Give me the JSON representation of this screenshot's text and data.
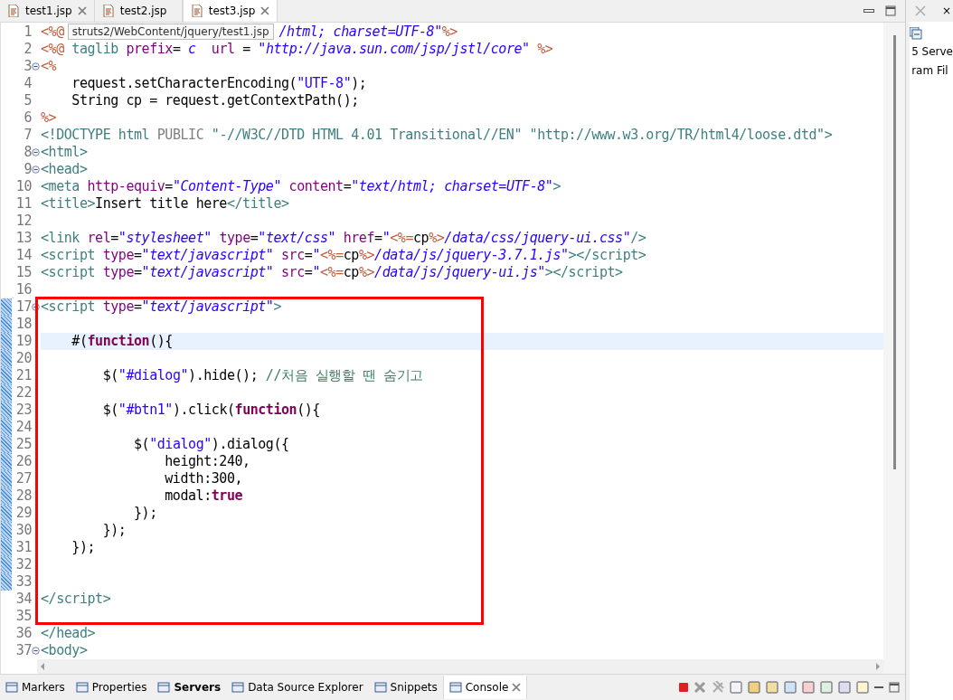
{
  "editor_tabs": [
    {
      "label": "test1.jsp",
      "selected": false,
      "closable": true
    },
    {
      "label": "test2.jsp",
      "selected": false,
      "closable": false
    },
    {
      "label": "test3.jsp",
      "selected": true,
      "closable": true
    }
  ],
  "blocks": [
    {
      "boxed": false,
      "lines": [
        {
          "number": "1",
          "fold": false,
          "changed": false,
          "current": false,
          "tokens": [
            {
              "kind": "jsp",
              "text": "<%@"
            },
            {
              "kind": "tooltip",
              "text": "struts2/WebContent/jquery/test1.jsp"
            },
            {
              "kind": "value",
              "text": "/html; charset=UTF-8\""
            },
            {
              "kind": "jsp",
              "text": "%>"
            }
          ]
        },
        {
          "number": "2",
          "fold": false,
          "changed": false,
          "current": false,
          "tokens": [
            {
              "kind": "jsp",
              "text": "<%@"
            },
            {
              "kind": "tag",
              "text": " taglib"
            },
            {
              "kind": "attr",
              "text": " prefix"
            },
            {
              "kind": "text",
              "text": "="
            },
            {
              "kind": "value",
              "text": " c"
            },
            {
              "kind": "attr",
              "text": "  url"
            },
            {
              "kind": "text",
              "text": " = "
            },
            {
              "kind": "value",
              "text": "\"http://java.sun.com/jsp/jstl/core\""
            },
            {
              "kind": "jsp",
              "text": " %>"
            }
          ]
        },
        {
          "number": "3",
          "fold": true,
          "changed": false,
          "current": false,
          "tokens": [
            {
              "kind": "jsp",
              "text": "<%"
            }
          ]
        },
        {
          "number": "4",
          "fold": false,
          "changed": false,
          "current": false,
          "tokens": [
            {
              "kind": "text",
              "text": "    request.setCharacterEncoding("
            },
            {
              "kind": "string",
              "text": "\"UTF-8\""
            },
            {
              "kind": "text",
              "text": ");"
            }
          ]
        },
        {
          "number": "5",
          "fold": false,
          "changed": false,
          "current": false,
          "tokens": [
            {
              "kind": "text",
              "text": "    String cp = request.getContextPath();"
            }
          ]
        },
        {
          "number": "6",
          "fold": false,
          "changed": false,
          "current": false,
          "tokens": [
            {
              "kind": "jsp",
              "text": "%>"
            }
          ]
        },
        {
          "number": "7",
          "fold": false,
          "changed": false,
          "current": false,
          "tokens": [
            {
              "kind": "tag",
              "text": "<!DOCTYPE html"
            },
            {
              "kind": "doctype",
              "text": " PUBLIC "
            },
            {
              "kind": "tag",
              "text": "\"-//W3C//DTD HTML 4.01 Transitional//EN\" \"http://www.w3.org/TR/html4/loose.dtd\">"
            }
          ]
        },
        {
          "number": "8",
          "fold": true,
          "changed": false,
          "current": false,
          "tokens": [
            {
              "kind": "tag",
              "text": "<html>"
            }
          ]
        },
        {
          "number": "9",
          "fold": true,
          "changed": false,
          "current": false,
          "tokens": [
            {
              "kind": "tag",
              "text": "<head>"
            }
          ]
        },
        {
          "number": "10",
          "fold": false,
          "changed": false,
          "current": false,
          "tokens": [
            {
              "kind": "tag",
              "text": "<meta"
            },
            {
              "kind": "attr",
              "text": " http-equiv"
            },
            {
              "kind": "text",
              "text": "="
            },
            {
              "kind": "value",
              "text": "\"Content-Type\""
            },
            {
              "kind": "attr",
              "text": " content"
            },
            {
              "kind": "text",
              "text": "="
            },
            {
              "kind": "value",
              "text": "\"text/html; charset=UTF-8\""
            },
            {
              "kind": "tag",
              "text": ">"
            }
          ]
        },
        {
          "number": "11",
          "fold": false,
          "changed": false,
          "current": false,
          "tokens": [
            {
              "kind": "tag",
              "text": "<title>"
            },
            {
              "kind": "text",
              "text": "Insert title here"
            },
            {
              "kind": "tag",
              "text": "</title>"
            }
          ]
        },
        {
          "number": "12",
          "fold": false,
          "changed": false,
          "current": false
        },
        {
          "number": "13",
          "fold": false,
          "changed": false,
          "current": false,
          "tokens": [
            {
              "kind": "tag",
              "text": "<link"
            },
            {
              "kind": "attr",
              "text": " rel"
            },
            {
              "kind": "text",
              "text": "="
            },
            {
              "kind": "value",
              "text": "\"stylesheet\""
            },
            {
              "kind": "attr",
              "text": " type"
            },
            {
              "kind": "text",
              "text": "="
            },
            {
              "kind": "value",
              "text": "\"text/css\""
            },
            {
              "kind": "attr",
              "text": " href"
            },
            {
              "kind": "text",
              "text": "="
            },
            {
              "kind": "value",
              "text": "\""
            },
            {
              "kind": "jsp",
              "text": "<%="
            },
            {
              "kind": "text",
              "text": "cp"
            },
            {
              "kind": "jsp",
              "text": "%>"
            },
            {
              "kind": "value",
              "text": "/data/css/jquery-ui.css\""
            },
            {
              "kind": "tag",
              "text": "/>"
            }
          ]
        },
        {
          "number": "14",
          "fold": false,
          "changed": false,
          "current": false,
          "tokens": [
            {
              "kind": "tag",
              "text": "<script"
            },
            {
              "kind": "attr",
              "text": " type"
            },
            {
              "kind": "text",
              "text": "="
            },
            {
              "kind": "value",
              "text": "\"text/javascript\""
            },
            {
              "kind": "attr",
              "text": " src"
            },
            {
              "kind": "text",
              "text": "="
            },
            {
              "kind": "value",
              "text": "\""
            },
            {
              "kind": "jsp",
              "text": "<%="
            },
            {
              "kind": "text",
              "text": "cp"
            },
            {
              "kind": "jsp",
              "text": "%>"
            },
            {
              "kind": "value",
              "text": "/data/js/jquery-3.7.1.js\""
            },
            {
              "kind": "tag",
              "text": "></script>"
            }
          ]
        },
        {
          "number": "15",
          "fold": false,
          "changed": false,
          "current": false,
          "tokens": [
            {
              "kind": "tag",
              "text": "<script"
            },
            {
              "kind": "attr",
              "text": " type"
            },
            {
              "kind": "text",
              "text": "="
            },
            {
              "kind": "value",
              "text": "\"text/javascript\""
            },
            {
              "kind": "attr",
              "text": " src"
            },
            {
              "kind": "text",
              "text": "="
            },
            {
              "kind": "value",
              "text": "\""
            },
            {
              "kind": "jsp",
              "text": "<%="
            },
            {
              "kind": "text",
              "text": "cp"
            },
            {
              "kind": "jsp",
              "text": "%>"
            },
            {
              "kind": "value",
              "text": "/data/js/jquery-ui.js\""
            },
            {
              "kind": "tag",
              "text": "></script>"
            }
          ]
        },
        {
          "number": "16",
          "fold": false,
          "changed": false,
          "current": false
        }
      ]
    },
    {
      "boxed": true,
      "lines": [
        {
          "number": "17",
          "fold": true,
          "changed": true,
          "current": false,
          "tokens": [
            {
              "kind": "tag",
              "text": "<script"
            },
            {
              "kind": "attr",
              "text": " type"
            },
            {
              "kind": "text",
              "text": "="
            },
            {
              "kind": "value",
              "text": "\"text/javascript\""
            },
            {
              "kind": "tag",
              "text": ">"
            }
          ]
        },
        {
          "number": "18",
          "fold": false,
          "changed": true,
          "current": false
        },
        {
          "number": "19",
          "fold": false,
          "changed": true,
          "current": true,
          "tokens": [
            {
              "kind": "text",
              "text": "    #("
            },
            {
              "kind": "keyword",
              "text": "function"
            },
            {
              "kind": "text",
              "text": "(){"
            }
          ]
        },
        {
          "number": "20",
          "fold": false,
          "changed": true,
          "current": false
        },
        {
          "number": "21",
          "fold": false,
          "changed": true,
          "current": false,
          "tokens": [
            {
              "kind": "text",
              "text": "        $("
            },
            {
              "kind": "string",
              "text": "\"#dialog\""
            },
            {
              "kind": "text",
              "text": ").hide(); "
            },
            {
              "kind": "comment",
              "text": "//처음 실행할 땐 숨기고"
            }
          ]
        },
        {
          "number": "22",
          "fold": false,
          "changed": true,
          "current": false
        },
        {
          "number": "23",
          "fold": false,
          "changed": true,
          "current": false,
          "tokens": [
            {
              "kind": "text",
              "text": "        $("
            },
            {
              "kind": "string",
              "text": "\"#btn1\""
            },
            {
              "kind": "text",
              "text": ").click("
            },
            {
              "kind": "keyword",
              "text": "function"
            },
            {
              "kind": "text",
              "text": "(){"
            }
          ]
        },
        {
          "number": "24",
          "fold": false,
          "changed": true,
          "current": false
        },
        {
          "number": "25",
          "fold": false,
          "changed": true,
          "current": false,
          "tokens": [
            {
              "kind": "text",
              "text": "            $("
            },
            {
              "kind": "string",
              "text": "\"dialog\""
            },
            {
              "kind": "text",
              "text": ").dialog({"
            }
          ]
        },
        {
          "number": "26",
          "fold": false,
          "changed": true,
          "current": false,
          "tokens": [
            {
              "kind": "text",
              "text": "                height:240,"
            }
          ]
        },
        {
          "number": "27",
          "fold": false,
          "changed": true,
          "current": false,
          "tokens": [
            {
              "kind": "text",
              "text": "                width:300,"
            }
          ]
        },
        {
          "number": "28",
          "fold": false,
          "changed": true,
          "current": false,
          "tokens": [
            {
              "kind": "text",
              "text": "                modal:"
            },
            {
              "kind": "keyword",
              "text": "true"
            }
          ]
        },
        {
          "number": "29",
          "fold": false,
          "changed": true,
          "current": false,
          "tokens": [
            {
              "kind": "text",
              "text": "            });"
            }
          ]
        },
        {
          "number": "30",
          "fold": false,
          "changed": true,
          "current": false,
          "tokens": [
            {
              "kind": "text",
              "text": "        });"
            }
          ]
        },
        {
          "number": "31",
          "fold": false,
          "changed": true,
          "current": false,
          "tokens": [
            {
              "kind": "text",
              "text": "    });"
            }
          ]
        },
        {
          "number": "32",
          "fold": false,
          "changed": true,
          "current": false
        },
        {
          "number": "33",
          "fold": false,
          "changed": true,
          "current": false
        },
        {
          "number": "34",
          "fold": false,
          "changed": false,
          "current": false,
          "tokens": [
            {
              "kind": "tag",
              "text": "</script>"
            }
          ]
        },
        {
          "number": "35",
          "fold": false,
          "changed": false,
          "current": false
        }
      ]
    },
    {
      "boxed": false,
      "lines": [
        {
          "number": "36",
          "fold": false,
          "changed": false,
          "current": false,
          "tokens": [
            {
              "kind": "tag",
              "text": "</head>"
            }
          ]
        },
        {
          "number": "37",
          "fold": true,
          "changed": false,
          "current": false,
          "tokens": [
            {
              "kind": "tag",
              "text": "<body>"
            }
          ]
        }
      ]
    }
  ],
  "bottom_tabs": [
    {
      "label": "Markers",
      "selected": false,
      "bold": false,
      "closable": false
    },
    {
      "label": "Properties",
      "selected": false,
      "bold": false,
      "closable": false
    },
    {
      "label": "Servers",
      "selected": false,
      "bold": true,
      "closable": false
    },
    {
      "label": "Data Source Explorer",
      "selected": false,
      "bold": false,
      "closable": false
    },
    {
      "label": "Snippets",
      "selected": false,
      "bold": false,
      "closable": false
    },
    {
      "label": "Console",
      "selected": true,
      "bold": false,
      "closable": true
    }
  ],
  "side_panel": {
    "close_glyph": "×",
    "lines": [
      "5 Serve",
      "ram Fil"
    ]
  }
}
